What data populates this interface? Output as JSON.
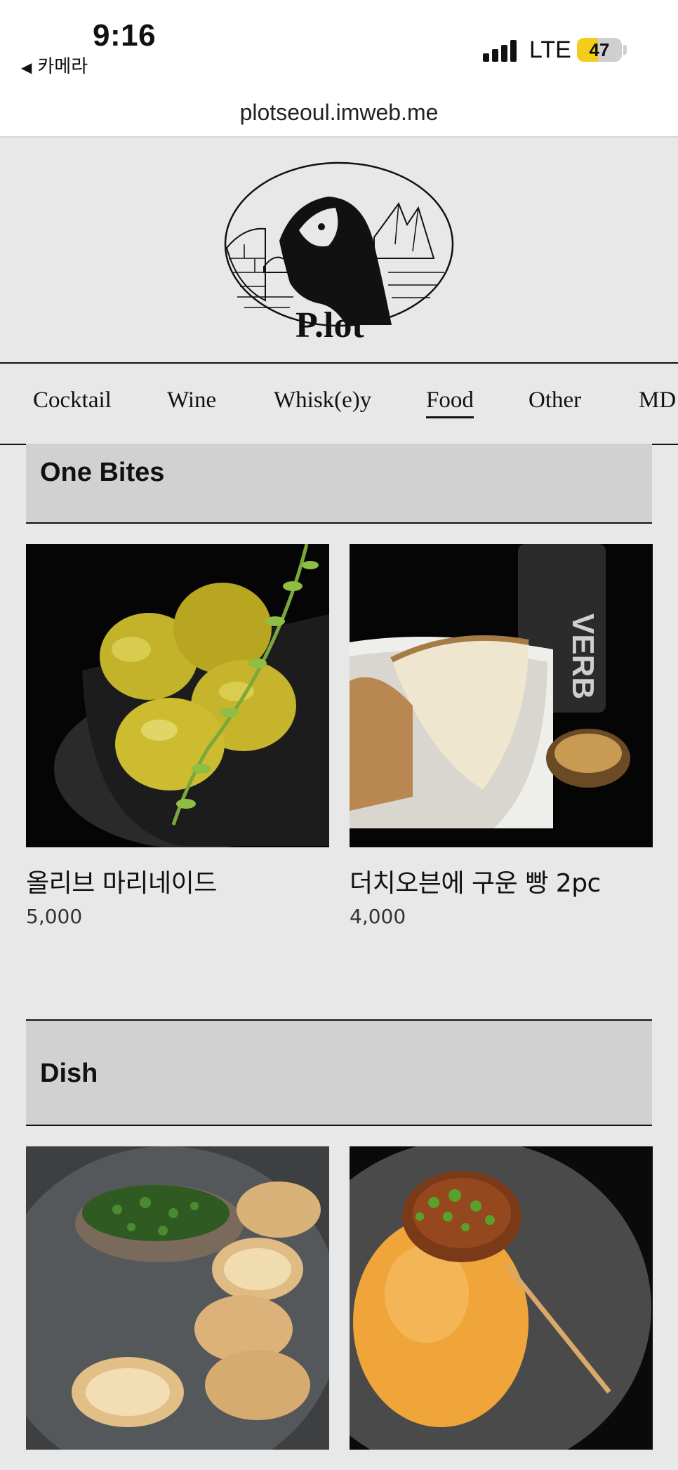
{
  "status_bar": {
    "time": "9:16",
    "back_label": "카메라",
    "network": "LTE",
    "battery": "47",
    "battery_level": 0.47
  },
  "browser": {
    "url": "plotseoul.imweb.me"
  },
  "logo": {
    "icon": "penguin-logo-icon"
  },
  "nav": {
    "items": [
      "Cocktail",
      "Wine",
      "Whisk(e)y",
      "Food",
      "Other",
      "MD"
    ],
    "active": "Food"
  },
  "sections": [
    {
      "title": "One Bites",
      "products": [
        {
          "name": "올리브 마리네이드",
          "price": "5,000",
          "image": "marinated-olives-photo"
        },
        {
          "name": "더치오븐에 구운 빵 2pc",
          "price": "4,000",
          "image": "dutch-oven-bread-photo"
        }
      ]
    },
    {
      "title": "Dish",
      "products": [
        {
          "name": "",
          "price": "",
          "image": "pate-with-toast-photo"
        },
        {
          "name": "",
          "price": "",
          "image": "croquette-with-sauce-photo"
        }
      ]
    }
  ],
  "colors": {
    "page_bg": "#e8e8e8",
    "section_header_bg": "#d1d1d1",
    "battery_fill": "#f4cc1c",
    "text": "#111111"
  }
}
